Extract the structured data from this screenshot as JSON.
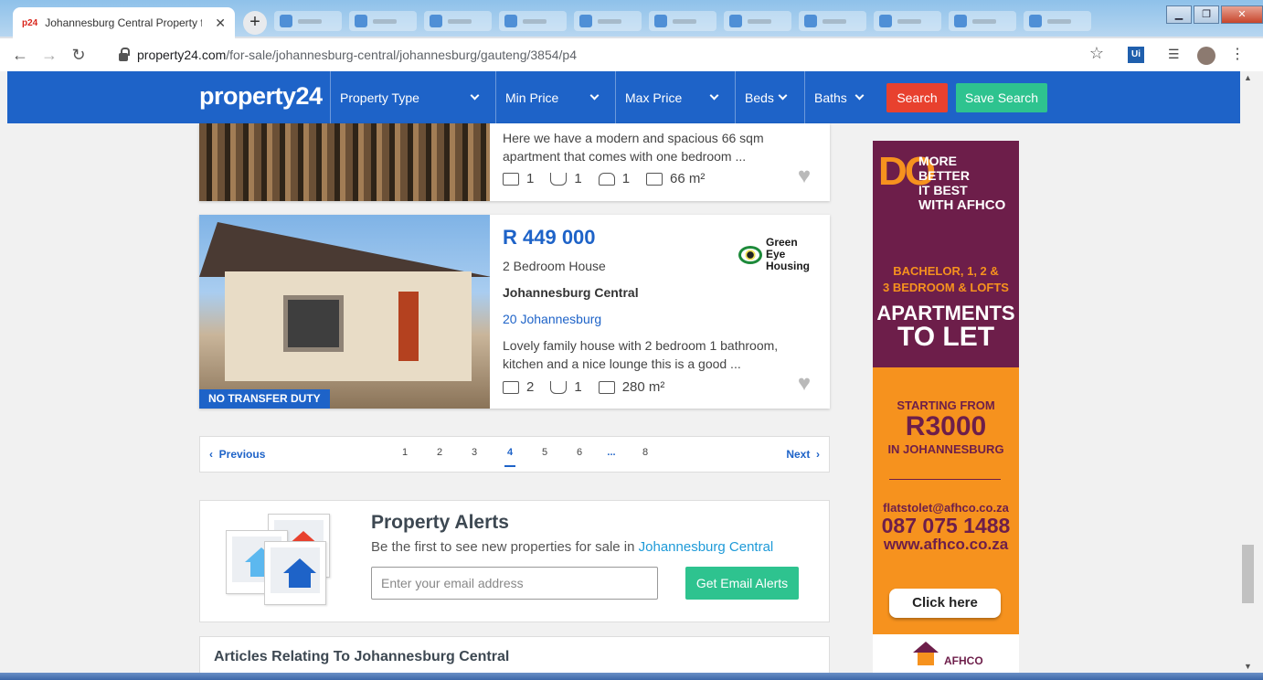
{
  "browser": {
    "tab_title": "Johannesburg Central Property f",
    "tab_favicon": "p24",
    "url_host": "property24.com",
    "url_path": "/for-sale/johannesburg-central/johannesburg/gauteng/3854/p4",
    "ext_ui_label": "Ui"
  },
  "header": {
    "logo": "property24",
    "filters": [
      {
        "label": "Property Type"
      },
      {
        "label": "Min Price"
      },
      {
        "label": "Max Price"
      },
      {
        "label": "Beds"
      },
      {
        "label": "Baths"
      }
    ],
    "search_label": "Search",
    "save_search_label": "Save Search"
  },
  "listing1": {
    "description_line1": "Here we have a modern and spacious 66 sqm",
    "description_line2": "apartment that comes with one bedroom ...",
    "beds": "1",
    "baths": "1",
    "parking": "1",
    "size": "66 m²"
  },
  "listing2": {
    "price": "R 449 000",
    "type": "2 Bedroom House",
    "suburb": "Johannesburg Central",
    "address": "20 Johannesburg",
    "description_line1": "Lovely family house with 2 bedroom 1 bathroom,",
    "description_line2": "kitchen and a nice lounge this is a good ...",
    "beds": "2",
    "baths": "1",
    "size": "280 m²",
    "badge": "NO TRANSFER DUTY",
    "agency_line1": "Green Eye",
    "agency_line2": "Housing"
  },
  "pagination": {
    "prev": "Previous",
    "next": "Next",
    "pages": [
      "1",
      "2",
      "3",
      "4",
      "5",
      "6",
      "...",
      "8"
    ],
    "current": "4"
  },
  "alerts": {
    "title": "Property Alerts",
    "subtitle_prefix": "Be the first to see new properties for sale in ",
    "subtitle_link": "Johannesburg Central",
    "email_placeholder": "Enter your email address",
    "button": "Get Email Alerts"
  },
  "articles": {
    "title": "Articles Relating To Johannesburg Central"
  },
  "ad": {
    "do": "DO",
    "line1": "MORE",
    "line2": "BETTER",
    "line3": "IT BEST",
    "line4": "WITH AFHCO",
    "bachelor_line1": "BACHELOR, 1, 2 &",
    "bachelor_line2": "3 BEDROOM & LOFTS",
    "apartments": "APARTMENTS",
    "to_let": "TO LET",
    "starting": "STARTING FROM",
    "price": "R3000",
    "location": "IN JOHANNESBURG",
    "email": "flatstolet@afhco.co.za",
    "phone": "087 075 1488",
    "web": "www.afhco.co.za",
    "cta": "Click here",
    "brand": "AFHCO"
  },
  "colors": {
    "brand_blue": "#1e63c8",
    "search_red": "#e8412e",
    "action_green": "#2ec38f",
    "ad_plum": "#6d1e4a",
    "ad_orange": "#f6921e"
  }
}
